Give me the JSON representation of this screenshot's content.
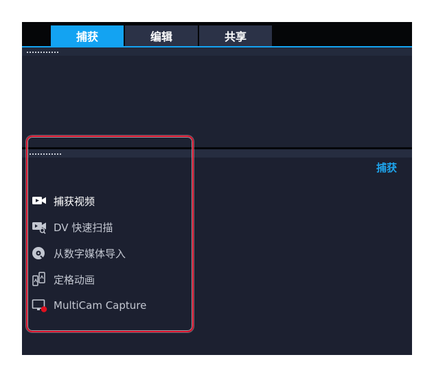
{
  "tabs": [
    {
      "label": "捕获",
      "active": true
    },
    {
      "label": "编辑",
      "active": false
    },
    {
      "label": "共享",
      "active": false
    }
  ],
  "panel": {
    "title": "捕获",
    "items": [
      {
        "label": "捕获视频",
        "icon": "video-camera-icon"
      },
      {
        "label": "DV 快速扫描",
        "icon": "dv-scan-icon"
      },
      {
        "label": "从数字媒体导入",
        "icon": "disc-import-icon"
      },
      {
        "label": "定格动画",
        "icon": "stop-motion-icon"
      },
      {
        "label": "MultiCam Capture",
        "icon": "screen-record-icon"
      }
    ]
  },
  "colors": {
    "accent": "#13a3f2",
    "panel_title": "#1ea4ec",
    "highlight": "#d9102a",
    "record_dot": "#e0101e",
    "background": "#1c2030"
  }
}
